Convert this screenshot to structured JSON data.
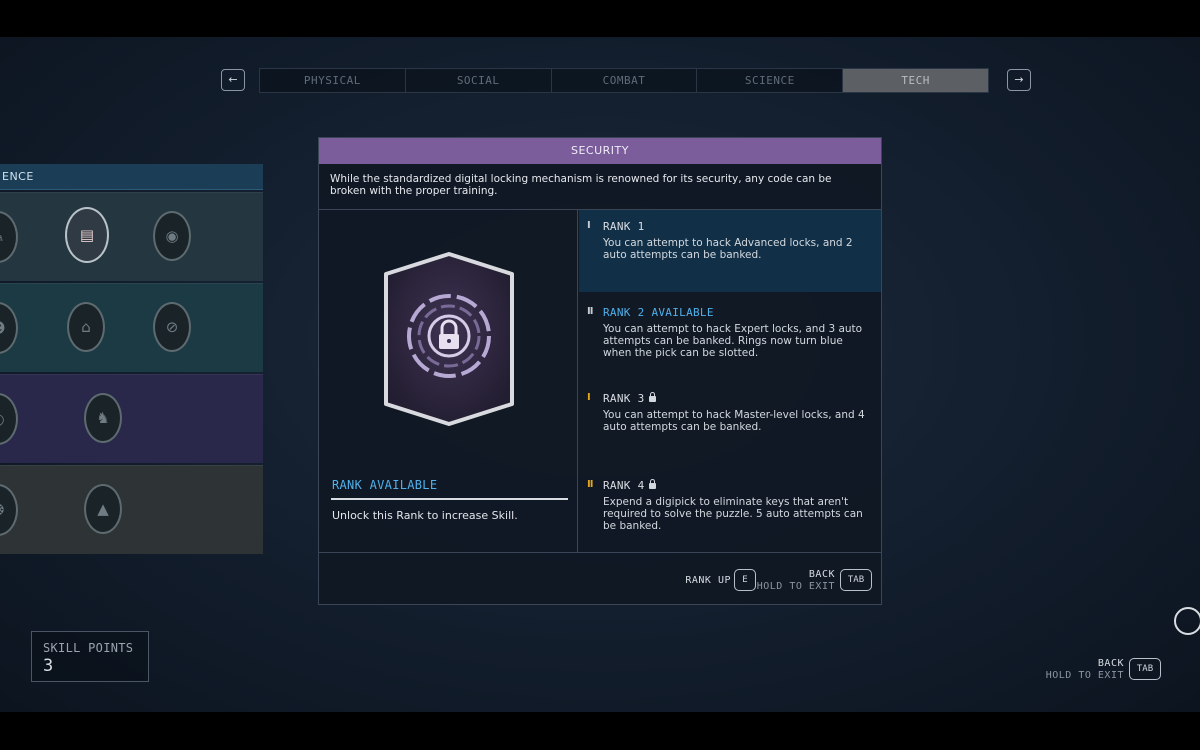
{
  "nav": {
    "prev_icon": "arrow-left-icon",
    "prev_glyph": "←",
    "next_icon": "arrow-right-icon",
    "next_glyph": "→"
  },
  "tabs": [
    {
      "label": "PHYSICAL",
      "active": false
    },
    {
      "label": "SOCIAL",
      "active": false
    },
    {
      "label": "COMBAT",
      "active": false
    },
    {
      "label": "SCIENCE",
      "active": false
    },
    {
      "label": "TECH",
      "active": true
    }
  ],
  "tree": {
    "header": "ENCE",
    "rows": [
      {
        "color": "#243640",
        "icons": [
          "wrench-icon",
          "document-icon",
          "signal-icon"
        ]
      },
      {
        "color": "#1c3a44",
        "icons": [
          "robot-icon",
          "terminal-icon",
          "no-entry-icon"
        ]
      },
      {
        "color": "#29284a",
        "icons": [
          "planet-icon",
          "creature-icon"
        ]
      },
      {
        "color": "#2e3336",
        "icons": [
          "circuit-icon",
          "compass-icon"
        ]
      }
    ]
  },
  "skill": {
    "title": "SECURITY",
    "description": "While the standardized digital locking mechanism is renowned for its security, any code can be broken with the proper training.",
    "badge_icon": "padlock-icon",
    "status_label": "RANK AVAILABLE",
    "status_hint": "Unlock this Rank to increase Skill.",
    "accent_color": "#7b5d9c",
    "ranks": [
      {
        "title": "RANK 1",
        "marks": "I",
        "mark_color": "#c8ccd2",
        "locked": false,
        "current": true,
        "text": "You can attempt to hack Advanced locks, and 2 auto attempts can be banked."
      },
      {
        "title": "RANK 2 AVAILABLE",
        "marks": "II",
        "mark_color": "#c8ccd2",
        "locked": false,
        "current": false,
        "available": true,
        "text": "You can attempt to hack Expert locks, and 3 auto attempts can be banked. Rings now turn blue when the pick can be slotted."
      },
      {
        "title": "RANK 3",
        "marks": "I",
        "mark_color": "#e3a51e",
        "locked": true,
        "current": false,
        "text": "You can attempt to hack Master-level locks, and 4 auto attempts can be banked."
      },
      {
        "title": "RANK 4",
        "marks": "II",
        "mark_color": "#e3a51e",
        "locked": true,
        "current": false,
        "text": "Expend a digipick to eliminate keys that aren't required to solve the puzzle. 5 auto attempts can be banked."
      }
    ]
  },
  "footer": {
    "rank_up_label": "RANK UP",
    "rank_up_key": "E",
    "back_label": "BACK",
    "back_sub": "HOLD TO EXIT",
    "back_key": "TAB"
  },
  "skill_points": {
    "label": "SKILL POINTS",
    "value": "3"
  },
  "screen_back": {
    "label": "BACK",
    "sub": "HOLD TO EXIT",
    "key": "TAB"
  }
}
